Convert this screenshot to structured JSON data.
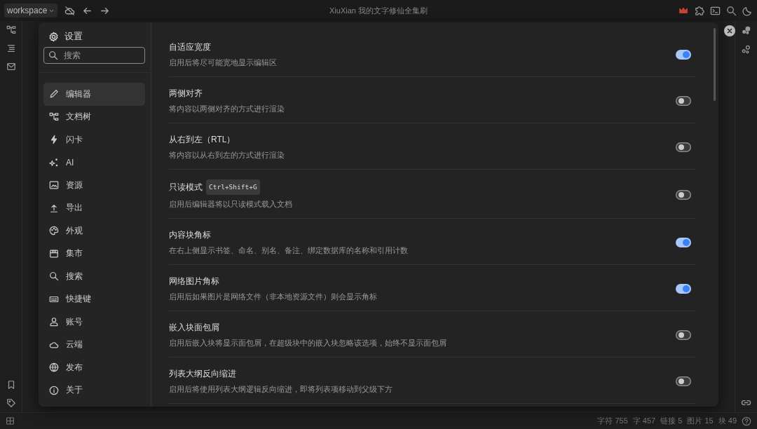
{
  "topbar": {
    "workspace": "workspace",
    "title": "XiuXian 我的文字修仙全集刷"
  },
  "settings": {
    "title": "设置",
    "search": {
      "placeholder": "搜索"
    },
    "nav": [
      {
        "label": "编辑器",
        "selected": true
      },
      {
        "label": "文档树",
        "selected": false
      },
      {
        "label": "闪卡",
        "selected": false
      },
      {
        "label": "AI",
        "selected": false
      },
      {
        "label": "资源",
        "selected": false
      },
      {
        "label": "导出",
        "selected": false
      },
      {
        "label": "外观",
        "selected": false
      },
      {
        "label": "集市",
        "selected": false
      },
      {
        "label": "搜索",
        "selected": false
      },
      {
        "label": "快捷键",
        "selected": false
      },
      {
        "label": "账号",
        "selected": false
      },
      {
        "label": "云端",
        "selected": false
      },
      {
        "label": "发布",
        "selected": false
      },
      {
        "label": "关于",
        "selected": false
      }
    ],
    "options": [
      {
        "title": "自适应宽度",
        "description": "启用后将尽可能宽地显示编辑区",
        "on": true
      },
      {
        "title": "两侧对齐",
        "description": "将内容以两侧对齐的方式进行渲染",
        "on": false
      },
      {
        "title": "从右到左（RTL）",
        "description": "将内容以从右到左的方式进行渲染",
        "on": false
      },
      {
        "title": "只读模式",
        "shortcut": "Ctrl+Shift+G",
        "description": "启用后编辑器将以只读模式载入文档",
        "on": false
      },
      {
        "title": "内容块角标",
        "description": "在右上侧显示书签、命名、别名、备注、绑定数据库的名称和引用计数",
        "on": true
      },
      {
        "title": "网络图片角标",
        "description": "启用后如果图片是网络文件（非本地资源文件）则会显示角标",
        "on": true
      },
      {
        "title": "嵌入块面包屑",
        "description": "启用后嵌入块将显示面包屑，在超级块中的嵌入块忽略该选项，始终不显示面包屑",
        "on": false
      },
      {
        "title": "列表大纲反向缩进",
        "description": "启用后将使用列表大纲逻辑反向缩进，即将列表项移动到父级下方",
        "on": false
      }
    ]
  },
  "status_bar": {
    "stats": [
      "字符 755",
      "字 457",
      "链接 5",
      "图片 15",
      "块 49"
    ]
  }
}
